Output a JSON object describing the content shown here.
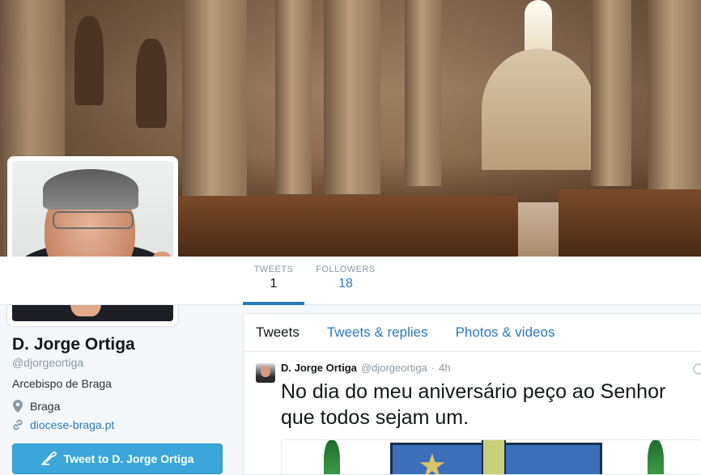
{
  "profile": {
    "name": "D. Jorge Ortiga",
    "handle": "@djorgeortiga",
    "bio": "Arcebispo de Braga",
    "location": "Braga",
    "url": "diocese-braga.pt",
    "tweet_to_label": "Tweet to D. Jorge Ortiga"
  },
  "stats": {
    "tweets_label": "TWEETS",
    "tweets_value": "1",
    "followers_label": "FOLLOWERS",
    "followers_value": "18"
  },
  "tabs": [
    {
      "label": "Tweets",
      "active": true
    },
    {
      "label": "Tweets & replies",
      "active": false
    },
    {
      "label": "Photos & videos",
      "active": false
    }
  ],
  "tweet": {
    "name": "D. Jorge Ortiga",
    "handle": "@djorgeortiga",
    "separator": "·",
    "time": "4h",
    "text": "No dia do meu aniversário peço ao Senhor que todos sejam um."
  },
  "icons": {
    "location": "map-pin-icon",
    "url": "link-icon",
    "tweet_to": "quill-icon"
  },
  "colors": {
    "accent": "#2b7bb9",
    "button": "#3ba7d9",
    "muted": "#8899a6"
  }
}
